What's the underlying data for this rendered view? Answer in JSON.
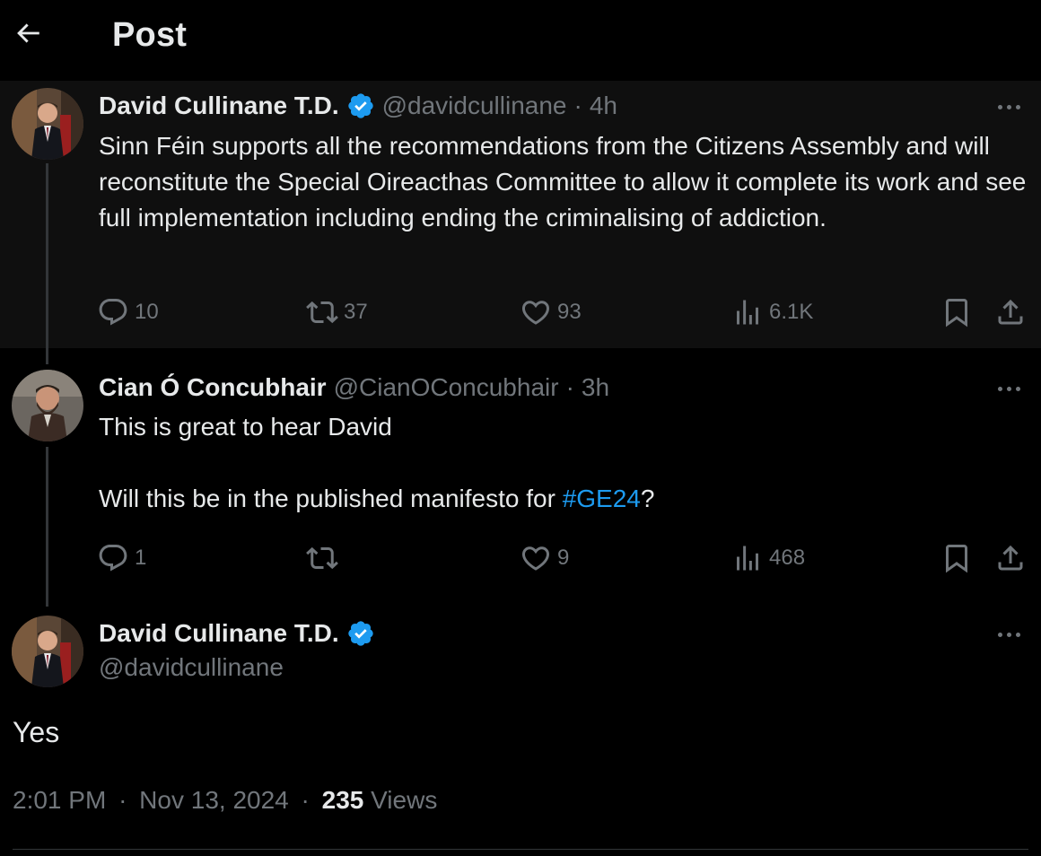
{
  "header": {
    "back_icon": "arrow-left-icon",
    "title": "Post"
  },
  "colors": {
    "background": "#000000",
    "highlight_background": "#0f0f0f",
    "text": "#e7e9ea",
    "muted": "#71767b",
    "accent": "#1d9bf0",
    "thread_line": "#333639"
  },
  "thread": [
    {
      "display_name": "David Cullinane T.D.",
      "verified": true,
      "handle": "@davidcullinane",
      "separator": "·",
      "time": "4h",
      "text": "Sinn Féin supports all the recommendations from the Citizens Assembly and will reconstitute the Special Oireacthas Committee to allow it complete its work and see full implementation including ending the criminalising of addiction.",
      "actions": {
        "replies": "10",
        "reposts": "37",
        "likes": "93",
        "views": "6.1K"
      }
    },
    {
      "display_name": "Cian Ó Concubhair",
      "verified": false,
      "handle": "@CianOConcubhair",
      "separator": "·",
      "time": "3h",
      "text_line1": "This is great to hear David",
      "text_line2_prefix": "Will this be in the published manifesto for ",
      "hashtag": "#GE24",
      "text_line2_suffix": "?",
      "actions": {
        "replies": "1",
        "reposts": "",
        "likes": "9",
        "views": "468"
      }
    }
  ],
  "main_post": {
    "display_name": "David Cullinane T.D.",
    "verified": true,
    "handle": "@davidcullinane",
    "text": "Yes",
    "time": "2:01 PM",
    "separator": "·",
    "date": "Nov 13, 2024",
    "views_count": "235",
    "views_label": "Views"
  },
  "icons": {
    "reply": "reply-icon",
    "repost": "repost-icon",
    "like": "heart-icon",
    "views": "views-icon",
    "bookmark": "bookmark-icon",
    "share": "share-icon",
    "more": "more-icon",
    "verified": "verified-badge-icon"
  }
}
